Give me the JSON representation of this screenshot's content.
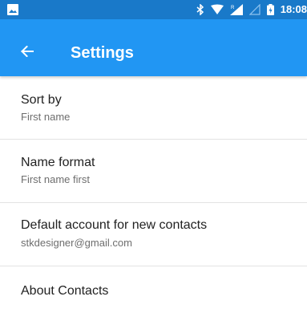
{
  "status_bar": {
    "time": "18:08",
    "icons": [
      "gallery-icon",
      "bluetooth-icon",
      "wifi-icon",
      "signal-icon",
      "signal-empty-icon",
      "battery-icon"
    ],
    "background": "#1979c9"
  },
  "app_bar": {
    "title": "Settings",
    "back_icon": "arrow-left-icon",
    "background": "#2196f3"
  },
  "settings": {
    "items": [
      {
        "title": "Sort by",
        "summary": "First name"
      },
      {
        "title": "Name format",
        "summary": "First name first"
      },
      {
        "title": "Default account for new contacts",
        "summary": "stkdesigner@gmail.com"
      },
      {
        "title": "About Contacts"
      }
    ]
  }
}
